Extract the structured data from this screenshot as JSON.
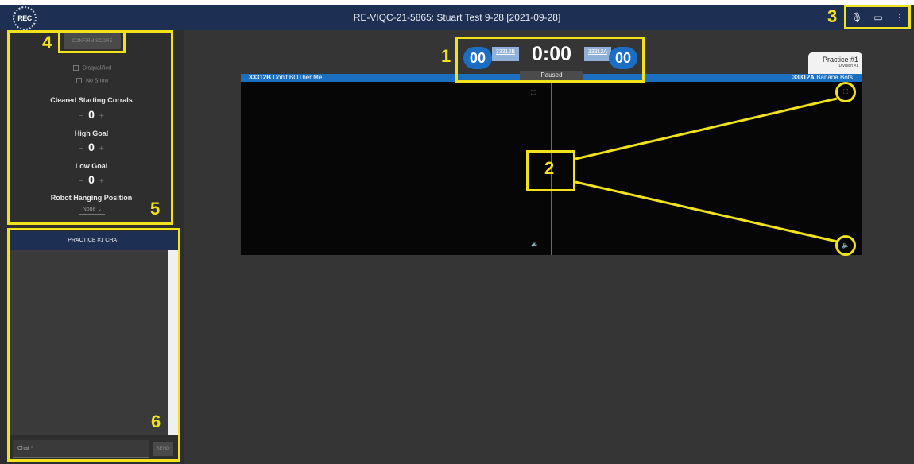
{
  "app": {
    "title": "RE-VIQC-21-5865: Stuart Test 9-28 [2021-09-28]",
    "logo_text": "REC"
  },
  "toolbar": {
    "mic_icon": "mic-icon",
    "chat_icon": "chat-bubble-icon",
    "menu_icon": "more-vertical-icon",
    "mic_glyph": "🎙",
    "chat_glyph": "▭",
    "menu_glyph": "⋮"
  },
  "scoring": {
    "confirm_label": "CONFIRM SCORE",
    "disqualified_label": "Disqualified",
    "no_show_label": "No Show",
    "fields": [
      {
        "label": "Cleared Starting Corrals",
        "value": "0"
      },
      {
        "label": "High Goal",
        "value": "0"
      },
      {
        "label": "Low Goal",
        "value": "0"
      }
    ],
    "hanging_label": "Robot Hanging Position",
    "hanging_value": "None",
    "minus": "−",
    "plus": "+"
  },
  "chat": {
    "header": "PRACTICE #1 CHAT",
    "input_placeholder": "Chat *",
    "send_label": "SEND"
  },
  "match": {
    "left_score": "00",
    "right_score": "00",
    "left_team_tag": "33312B",
    "right_team_tag": "33312A",
    "timer": "0:00",
    "status": "Paused",
    "left_team_number": "33312B",
    "left_team_name": "Don't BOTher Me",
    "right_team_number": "33312A",
    "right_team_name": "Banana Bots",
    "practice_title": "Practice #1",
    "division": "Division #1"
  },
  "video": {
    "fullscreen_glyph": "⛶",
    "volume_glyph": "🔈"
  },
  "callouts": [
    "1",
    "2",
    "3",
    "4",
    "5",
    "6"
  ],
  "colors": {
    "highlight": "#f2e21c",
    "topbar": "#1d2f52",
    "team_blue": "#1b6ec1"
  }
}
